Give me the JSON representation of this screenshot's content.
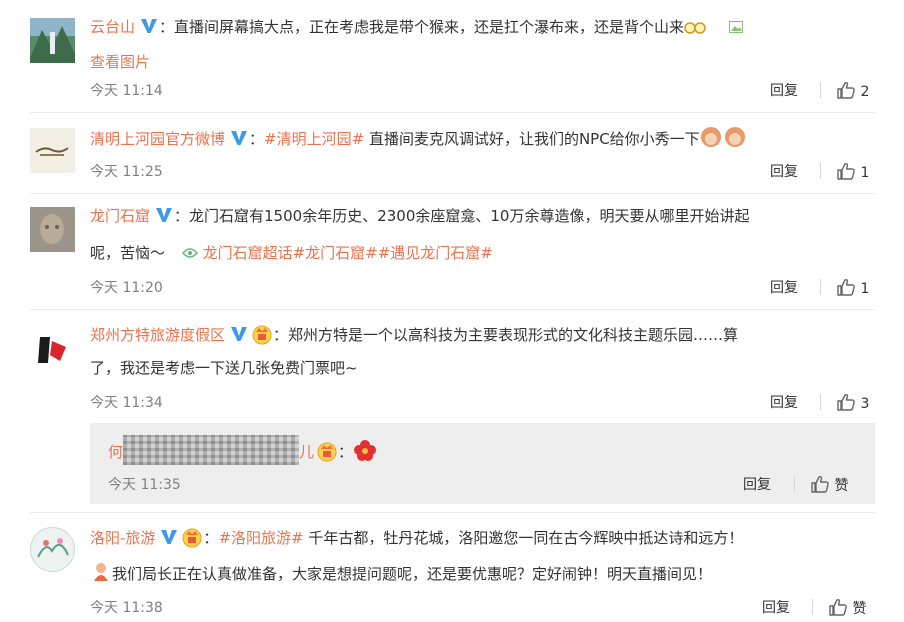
{
  "comments": [
    {
      "user": "云台山",
      "text": "：直播间屏幕搞大点，正在考虑我是带个猴来，还是扛个瀑布来，还是背个山来",
      "link": "查看图片",
      "time": "今天 11:14",
      "reply": "回复",
      "likes": "2"
    },
    {
      "user": "清明上河园官方微博",
      "topic": "#清明上河园#",
      "text": " 直播间麦克风调试好，让我们的NPC给你小秀一下",
      "time": "今天 11:25",
      "reply": "回复",
      "likes": "1"
    },
    {
      "user": "龙门石窟",
      "text1": "：龙门石窟有1500余年历史、2300余座窟龛、10万余尊造像，明天要从哪里开始讲起",
      "text2": "呢，苦恼～",
      "supertopic": "龙门石窟超话",
      "topic1": "#龙门石窟#",
      "topic2": "#遇见龙门石窟#",
      "time": "今天 11:20",
      "reply": "回复",
      "likes": "1"
    },
    {
      "user": "郑州方特旅游度假区",
      "text1": "：郑州方特是一个以高科技为主要表现形式的文化科技主题乐园……算",
      "text2": "了，我还是考虑一下送几张免费门票吧~",
      "time": "今天 11:34",
      "reply": "回复",
      "likes": "3"
    },
    {
      "user": "洛阳-旅游",
      "topic": "#洛阳旅游#",
      "text1": " 千年古都，牡丹花城，洛阳邀您一同在古今辉映中抵达诗和远方！",
      "text2": "我们局长正在认真做准备，大家是想提问题呢，还是要优惠呢？定好闹钟！明天直播间见！",
      "time": "今天 11:38",
      "reply": "回复",
      "likes": "赞"
    }
  ],
  "subcomment": {
    "user_prefix": "何",
    "user_suffix": "儿",
    "colon": "：",
    "time": "今天 11:35",
    "reply": "回复",
    "likes": "赞"
  },
  "colors": {
    "name": "#eb7350",
    "verified": "#3d9ae8",
    "time": "#808080"
  }
}
